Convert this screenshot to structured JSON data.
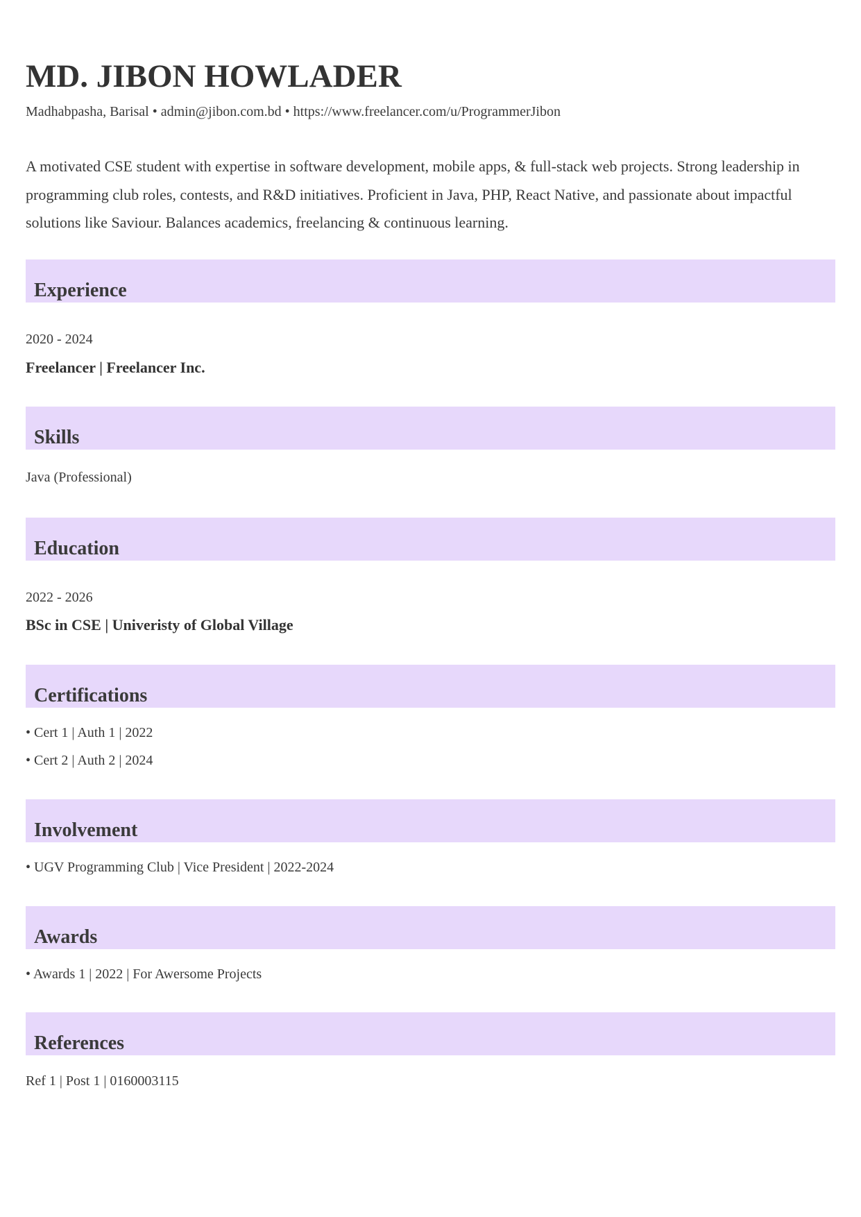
{
  "header": {
    "name": "MD. JIBON HOWLADER",
    "contact": "Madhabpasha, Barisal • admin@jibon.com.bd • https://www.freelancer.com/u/ProgrammerJibon"
  },
  "summary": "A motivated CSE student with expertise in software development, mobile apps, & full-stack web projects. Strong leadership in programming club roles, contests, and R&D initiatives. Proficient in Java, PHP, React Native, and passionate about impactful solutions like Saviour. Balances academics, freelancing & continuous learning.",
  "colors": {
    "section_bar": "#e7d8fb",
    "text": "#333333"
  },
  "experience": {
    "title": "Experience",
    "period": "2020 - 2024",
    "role": "Freelancer | Freelancer Inc."
  },
  "skills": {
    "title": "Skills",
    "items": [
      "Java (Professional)"
    ]
  },
  "education": {
    "title": "Education",
    "period": "2022 - 2026",
    "degree": "BSc in CSE | Univeristy of Global Village"
  },
  "certifications": {
    "title": "Certifications",
    "items": [
      "• Cert 1 | Auth 1 | 2022",
      "• Cert 2 | Auth 2 | 2024"
    ]
  },
  "involvement": {
    "title": "Involvement",
    "items": [
      "• UGV Programming Club | Vice President | 2022-2024"
    ]
  },
  "awards": {
    "title": "Awards",
    "items": [
      "• Awards 1 | 2022 | For Awersome Projects"
    ]
  },
  "references": {
    "title": "References",
    "items": [
      "Ref 1 | Post 1 | 0160003115"
    ]
  }
}
